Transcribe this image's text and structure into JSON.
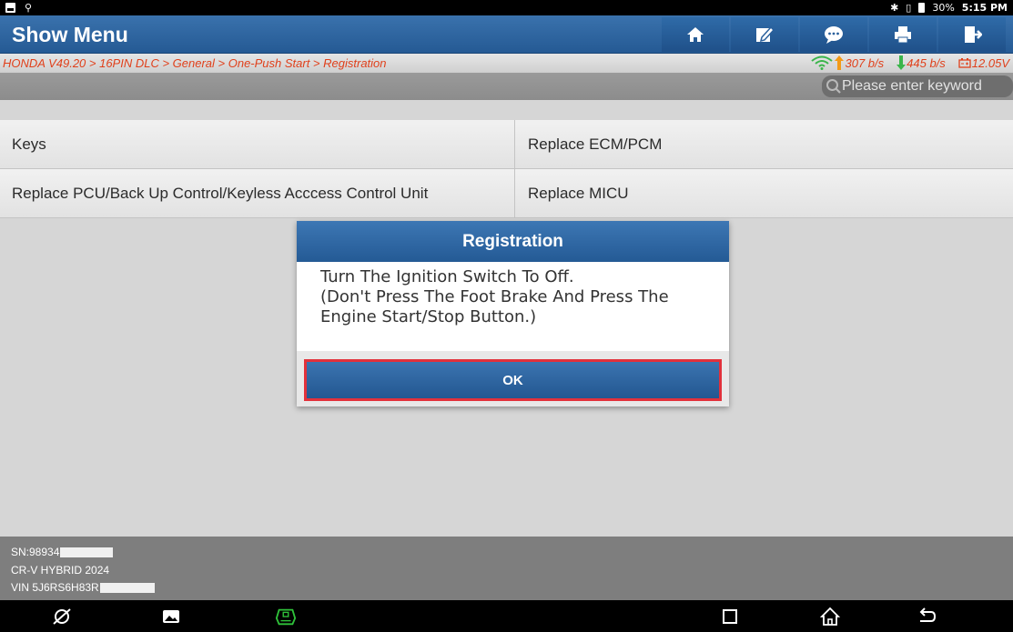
{
  "statusbar": {
    "left_icons": [
      "image-notification-icon",
      "usb-icon"
    ],
    "right_icons": [
      "bluetooth-icon",
      "vibrate-icon",
      "battery-icon"
    ],
    "battery": "30%",
    "time": "5:15 PM"
  },
  "titlebar": {
    "title": "Show Menu",
    "buttons": [
      "home-icon",
      "edit-report-icon",
      "message-icon",
      "print-icon",
      "exit-icon"
    ]
  },
  "breadcrumb": "HONDA V49.20 > 16PIN DLC > General > One-Push Start > Registration",
  "network": {
    "upload": "307 b/s",
    "download": "445 b/s",
    "voltage": "12.05V"
  },
  "search": {
    "placeholder": "Please enter keyword"
  },
  "menu": {
    "rows": [
      {
        "left": "Keys",
        "right": "Replace ECM/PCM"
      },
      {
        "left": "Replace PCU/Back Up Control/Keyless Acccess Control Unit",
        "right": "Replace MICU"
      }
    ]
  },
  "dialog": {
    "title": "Registration",
    "message": "Turn The Ignition Switch To Off.\n(Don't Press The Foot Brake And Press The\nEngine Start/Stop Button.)",
    "ok_label": "OK"
  },
  "vehicle": {
    "sn": "SN:98934",
    "model": "CR-V HYBRID 2024",
    "vin": "VIN 5J6RS6H83R"
  },
  "colors": {
    "title_blue": "#2e66a2",
    "breadcrumb_red": "#e0401b",
    "ok_border": "#e2313b",
    "vci_green": "#2fc23a"
  }
}
